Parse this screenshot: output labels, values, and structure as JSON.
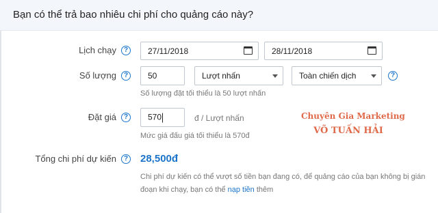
{
  "header": {
    "title": "Bạn có thể trả bao nhiêu chi phí cho quảng cáo này?"
  },
  "schedule": {
    "label": "Lịch chạy",
    "start_date": "27/11/2018",
    "end_date": "28/11/2018"
  },
  "quantity": {
    "label": "Số lượng",
    "value": "50",
    "unit_select": "Lượt nhấn",
    "scope_select": "Toàn chiến dịch",
    "hint": "Số lượng đặt tối thiểu là 50 lượt nhấn"
  },
  "bid": {
    "label": "Đặt giá",
    "value": "570",
    "unit": "đ / Lượt nhấn",
    "hint": "Mức giá đấu giá tối thiểu là 570đ"
  },
  "total": {
    "label": "Tổng chi phí dự kiến",
    "value": "28,500đ",
    "note_before": "Chi phí dự kiến có thể vượt số tiền bạn đang có, để quảng cáo của bạn không bị gián đoạn khi chạy, bạn có thể ",
    "note_link": "nạp tiền",
    "note_after": " thêm"
  },
  "watermark": {
    "line1": "Chuyên Gia Marketing",
    "line2": "VÕ TUẤN HẢI"
  },
  "icons": {
    "help": "help-circle-icon",
    "calendar": "calendar-icon",
    "dropdown": "caret-down-icon"
  },
  "colors": {
    "accent": "#1b74c9",
    "watermark": "#e0694a",
    "header_bg": "#f3f6fb"
  }
}
